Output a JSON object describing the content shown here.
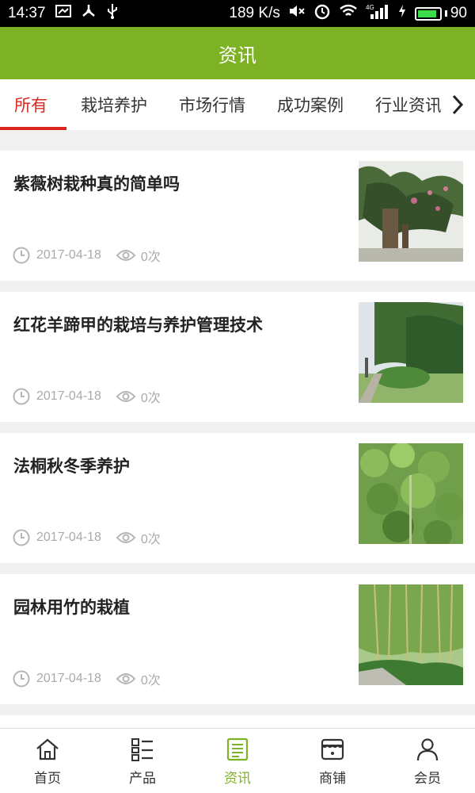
{
  "status_bar": {
    "time": "14:37",
    "net_speed": "189 K/s",
    "battery": "90",
    "battery_fraction": 0.9,
    "signal": "4G"
  },
  "header": {
    "title": "资讯"
  },
  "tabs": [
    {
      "label": "所有",
      "active": true
    },
    {
      "label": "栽培养护"
    },
    {
      "label": "市场行情"
    },
    {
      "label": "成功案例"
    },
    {
      "label": "行业资讯"
    }
  ],
  "news": [
    {
      "title": "紫薇树栽种真的简单吗",
      "date": "2017-04-18",
      "views": "0次"
    },
    {
      "title": "红花羊蹄甲的栽培与养护管理技术",
      "date": "2017-04-18",
      "views": "0次"
    },
    {
      "title": "法桐秋冬季养护",
      "date": "2017-04-18",
      "views": "0次"
    },
    {
      "title": "园林用竹的栽植",
      "date": "2017-04-18",
      "views": "0次"
    }
  ],
  "bottom_nav": [
    {
      "label": "首页",
      "icon": "home-icon"
    },
    {
      "label": "产品",
      "icon": "list-icon"
    },
    {
      "label": "资讯",
      "icon": "news-icon",
      "active": true
    },
    {
      "label": "商铺",
      "icon": "shop-icon"
    },
    {
      "label": "会员",
      "icon": "user-icon"
    }
  ],
  "colors": {
    "brand": "#7cb223",
    "active_tab": "#d9271f"
  }
}
